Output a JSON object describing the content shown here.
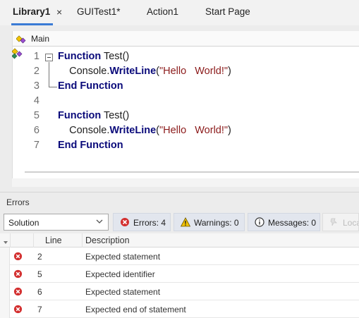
{
  "tabs": [
    {
      "label": "Library1",
      "active": true
    },
    {
      "label": "GUITest1*",
      "active": false
    },
    {
      "label": "Action1",
      "active": false
    },
    {
      "label": "Start Page",
      "active": false
    }
  ],
  "tab_close_glyph": "×",
  "editor": {
    "scope": "Main",
    "lines": [
      {
        "num": "1",
        "tokens": [
          {
            "t": "Function",
            "c": "kw"
          },
          {
            "t": " Test()",
            "c": ""
          }
        ]
      },
      {
        "num": "2",
        "tokens": [
          {
            "t": "    Console.",
            "c": ""
          },
          {
            "t": "WriteLine",
            "c": "kw"
          },
          {
            "t": "(",
            "c": ""
          },
          {
            "t": "\"Hello   World!\"",
            "c": "str"
          },
          {
            "t": ")",
            "c": ""
          }
        ]
      },
      {
        "num": "3",
        "tokens": [
          {
            "t": "End Function",
            "c": "kw"
          }
        ]
      },
      {
        "num": "4",
        "tokens": []
      },
      {
        "num": "5",
        "tokens": [
          {
            "t": "Function",
            "c": "kw"
          },
          {
            "t": " Test()",
            "c": ""
          }
        ]
      },
      {
        "num": "6",
        "tokens": [
          {
            "t": "    Console.",
            "c": ""
          },
          {
            "t": "WriteLine",
            "c": "kw"
          },
          {
            "t": "(",
            "c": ""
          },
          {
            "t": "\"Hello   World!\"",
            "c": "str"
          },
          {
            "t": ")",
            "c": ""
          }
        ]
      },
      {
        "num": "7",
        "tokens": [
          {
            "t": "End Function",
            "c": "kw"
          }
        ]
      }
    ]
  },
  "errors_panel": {
    "title": "Errors",
    "scope_select": "Solution",
    "filters": {
      "errors": "Errors: 4",
      "warnings": "Warnings: 0",
      "messages": "Messages: 0",
      "location": "Loca"
    },
    "columns": {
      "line": "Line",
      "description": "Description"
    },
    "rows": [
      {
        "line": "2",
        "description": "Expected statement"
      },
      {
        "line": "5",
        "description": "Expected identifier"
      },
      {
        "line": "6",
        "description": "Expected statement"
      },
      {
        "line": "7",
        "description": "Expected end of statement"
      }
    ]
  },
  "colors": {
    "keyword": "#0a0a7a",
    "string": "#8b1a1a",
    "error": "#d32f2f",
    "warning": "#f2c200",
    "tab_accent": "#3a7bd5"
  },
  "icons": {
    "scope": "function-scope-icon",
    "gutter": "function-scope-icon",
    "errors": "error-circle-icon",
    "warnings": "warning-triangle-icon",
    "messages": "info-circle-icon",
    "location": "pin-icon"
  }
}
